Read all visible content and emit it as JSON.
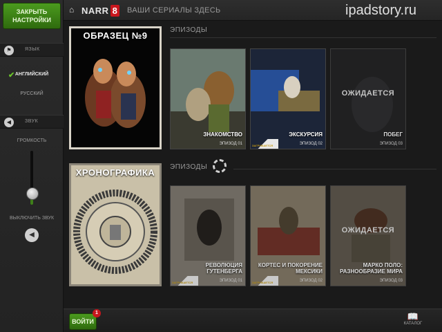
{
  "watermark": "ipadstory.ru",
  "sidebar": {
    "close_label": "ЗАКРЫТЬ НАСТРОЙКИ",
    "language": {
      "header": "ЯЗЫК",
      "options": [
        "АНГЛИЙСКИЙ",
        "РУССКИЙ"
      ],
      "selected": "АНГЛИЙСКИЙ"
    },
    "sound": {
      "header": "ЗВУК",
      "volume_label": "ГРОМКОСТЬ",
      "volume_level": 0.2,
      "mute_label": "ВЫКЛЮЧИТЬ ЗВУК"
    }
  },
  "header": {
    "logo_text": "NARR",
    "logo_number": "8",
    "tagline": "ВАШИ СЕРИАЛЫ ЗДЕСЬ"
  },
  "series": [
    {
      "title": "ОБРАЗЕЦ №9",
      "episodes_label": "ЭПИЗОДЫ",
      "episodes": [
        {
          "title": "ЗНАКОМСТВО",
          "number": "ЭПИЗОД 01",
          "status": "available"
        },
        {
          "title": "ЭКСКУРСИЯ",
          "number": "ЭПИЗОД 02",
          "status": "download",
          "badge": "ЗАГРУЖАЕТСЯ"
        },
        {
          "title": "ПОБЕГ",
          "number": "ЭПИЗОД 03",
          "status": "pending",
          "pending_label": "ОЖИДАЕТСЯ"
        }
      ]
    },
    {
      "title": "ХРОНОГРАФИКА",
      "episodes_label": "ЭПИЗОДЫ",
      "episodes": [
        {
          "title": "РЕВОЛЮЦИЯ ГУТЕНБЕРГА",
          "number": "ЭПИЗОД 01",
          "status": "download",
          "badge": "ЗАГРУЖАЕТСЯ"
        },
        {
          "title": "КОРТЕС И ПОКОРЕНИЕ МЕКСИКИ",
          "number": "ЭПИЗОД 02",
          "status": "download",
          "badge": "ЗАГРУЖАЕТСЯ"
        },
        {
          "title": "МАРКО ПОЛО: РАЗНООБРАЗИЕ МИРА",
          "number": "ЭПИЗОД 03",
          "status": "pending",
          "pending_label": "ОЖИДАЕТСЯ"
        }
      ]
    }
  ],
  "footer": {
    "login_label": "ВОЙТИ",
    "notification_count": "1",
    "catalog_label": "КАТАЛОГ"
  },
  "colors": {
    "accent_green": "#3f7f1a",
    "brand_red": "#c8161d",
    "background": "#1a1a1a"
  },
  "icons": {
    "home": "home-icon",
    "language": "flag-icon",
    "sound": "speaker-icon",
    "mute": "speaker-mute-icon",
    "catalog": "book-icon",
    "loading": "spinner-icon"
  }
}
